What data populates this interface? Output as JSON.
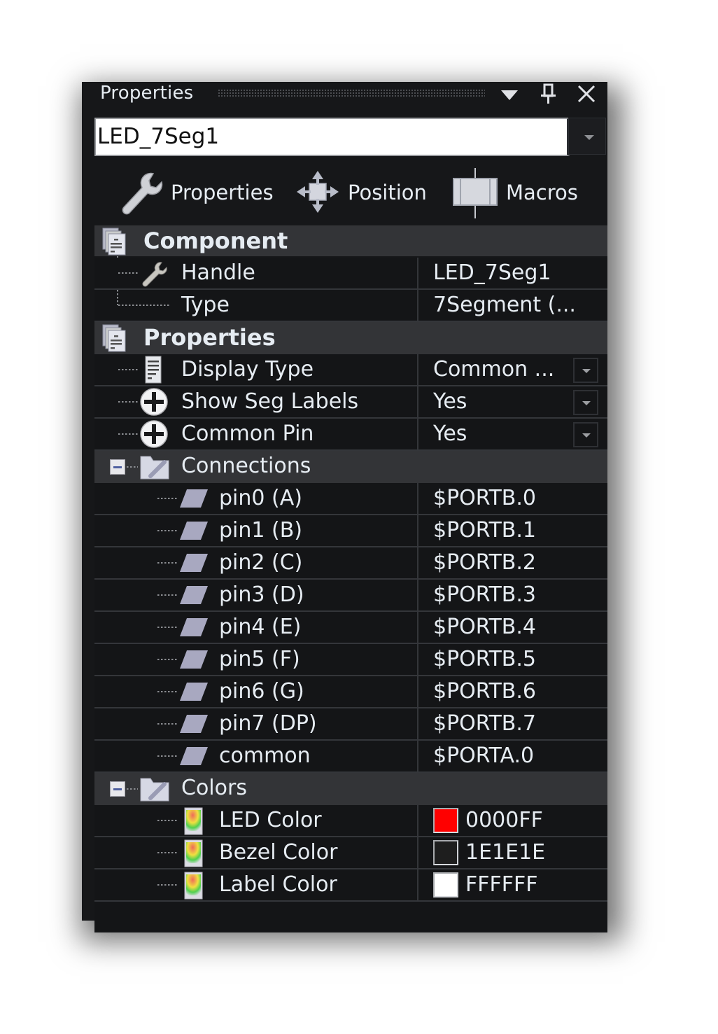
{
  "panel": {
    "title": "Properties",
    "title_icons": [
      "dropdown-arrow-icon",
      "pin-icon",
      "close-icon"
    ]
  },
  "component_selector": {
    "value": "LED_7Seg1"
  },
  "toolbar": {
    "tabs": [
      {
        "label": "Properties",
        "icon": "wrench-icon"
      },
      {
        "label": "Position",
        "icon": "move-arrows-icon"
      },
      {
        "label": "Macros",
        "icon": "macro-panel-icon"
      }
    ]
  },
  "grid": {
    "component": {
      "label": "Component",
      "rows": [
        {
          "name": "Handle",
          "value": "LED_7Seg1",
          "icon": "wrench-icon"
        },
        {
          "name": "Type",
          "value": "7Segment (..."
        }
      ]
    },
    "properties": {
      "label": "Properties",
      "rows": [
        {
          "name": "Display Type",
          "value": "Common ...",
          "icon": "document-list-icon"
        },
        {
          "name": "Show Seg Labels",
          "value": "Yes",
          "icon": "plus-circle-icon"
        },
        {
          "name": "Common Pin",
          "value": "Yes",
          "icon": "plus-circle-icon"
        }
      ]
    },
    "connections": {
      "label": "Connections",
      "rows": [
        {
          "name": "pin0 (A)",
          "value": "$PORTB.0"
        },
        {
          "name": "pin1 (B)",
          "value": "$PORTB.1"
        },
        {
          "name": "pin2 (C)",
          "value": "$PORTB.2"
        },
        {
          "name": "pin3 (D)",
          "value": "$PORTB.3"
        },
        {
          "name": "pin4 (E)",
          "value": "$PORTB.4"
        },
        {
          "name": "pin5  (F)",
          "value": "$PORTB.5"
        },
        {
          "name": "pin6 (G)",
          "value": "$PORTB.6"
        },
        {
          "name": "pin7 (DP)",
          "value": "$PORTB.7"
        },
        {
          "name": "common",
          "value": "$PORTA.0"
        }
      ]
    },
    "colors": {
      "label": "Colors",
      "rows": [
        {
          "name": "LED Color",
          "value": "0000FF",
          "swatch": "#ff0000"
        },
        {
          "name": "Bezel Color",
          "value": "1E1E1E",
          "swatch": "#1e1e1e"
        },
        {
          "name": "Label Color",
          "value": "FFFFFF",
          "swatch": "#ffffff"
        }
      ]
    }
  }
}
